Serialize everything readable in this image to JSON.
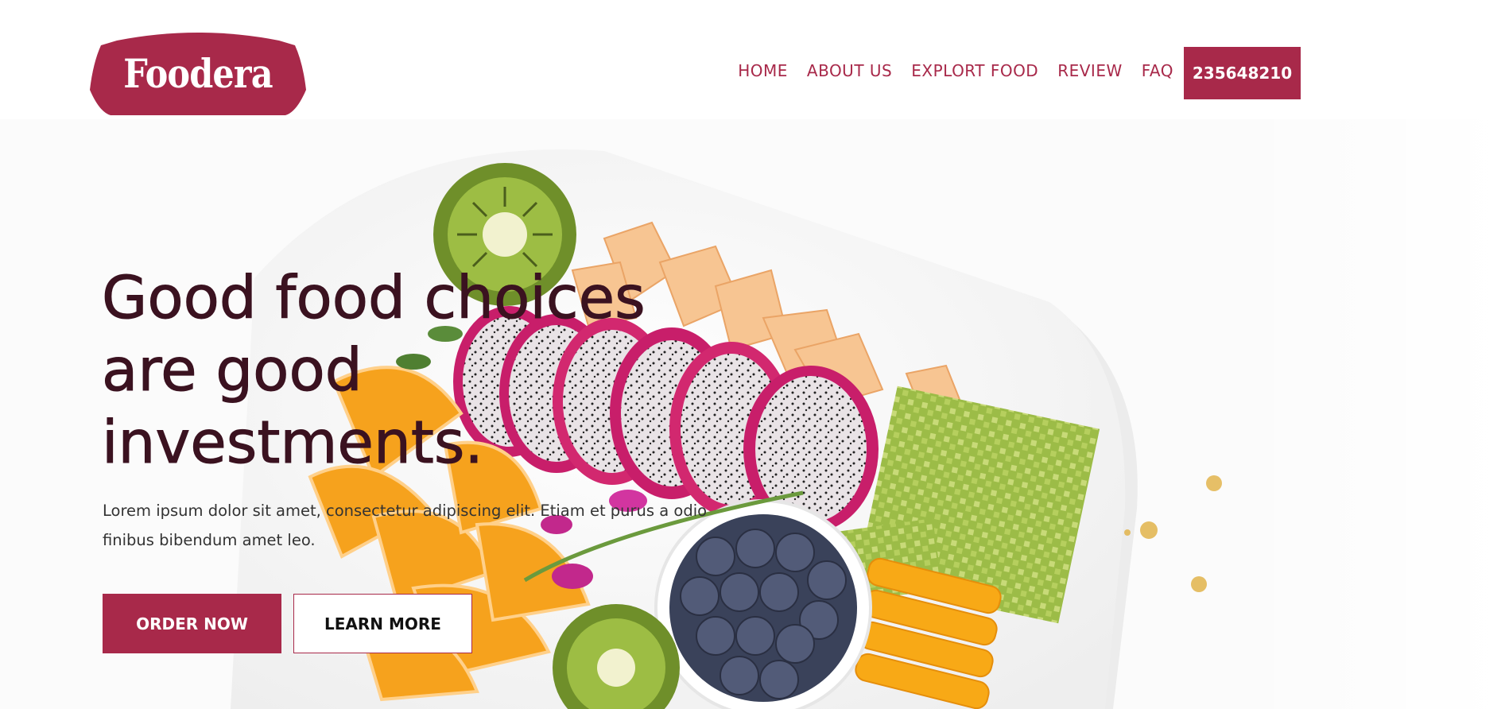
{
  "brand": {
    "name": "Foodera",
    "color": "#a8294a"
  },
  "nav": {
    "items": [
      "HOME",
      "ABOUT US",
      "EXPLORT FOOD",
      "REVIEW",
      "FAQ"
    ],
    "phone": "235648210"
  },
  "hero": {
    "title_lines": [
      "Good food choices",
      "are good",
      "investments."
    ],
    "description": "Lorem ipsum dolor sit amet, consectetur adipiscing elit. Etiam et purus a odio finibus bibendum amet leo.",
    "primary_button": "ORDER NOW",
    "secondary_button": "LEARN MORE"
  },
  "colors": {
    "accent": "#a8294a",
    "heading": "#3b1220",
    "body_text": "#333333"
  }
}
